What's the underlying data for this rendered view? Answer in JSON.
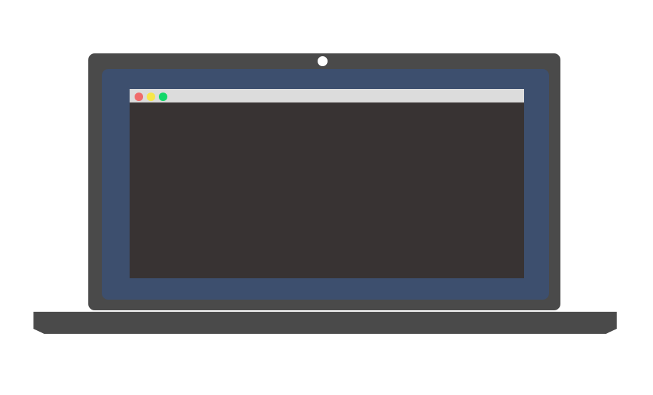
{
  "laptop": {
    "frame_color": "#4a4a4a",
    "camera_color": "#ffffff",
    "screen_color": "#3d4f6e",
    "base_color": "#4a4a4a"
  },
  "window": {
    "titlebar_color": "#dcdcdc",
    "content_color": "#383333",
    "controls": [
      {
        "name": "close-dot",
        "color": "#f06b6b"
      },
      {
        "name": "minimize-dot",
        "color": "#f7e64b"
      },
      {
        "name": "maximize-dot",
        "color": "#12d86a"
      }
    ]
  }
}
